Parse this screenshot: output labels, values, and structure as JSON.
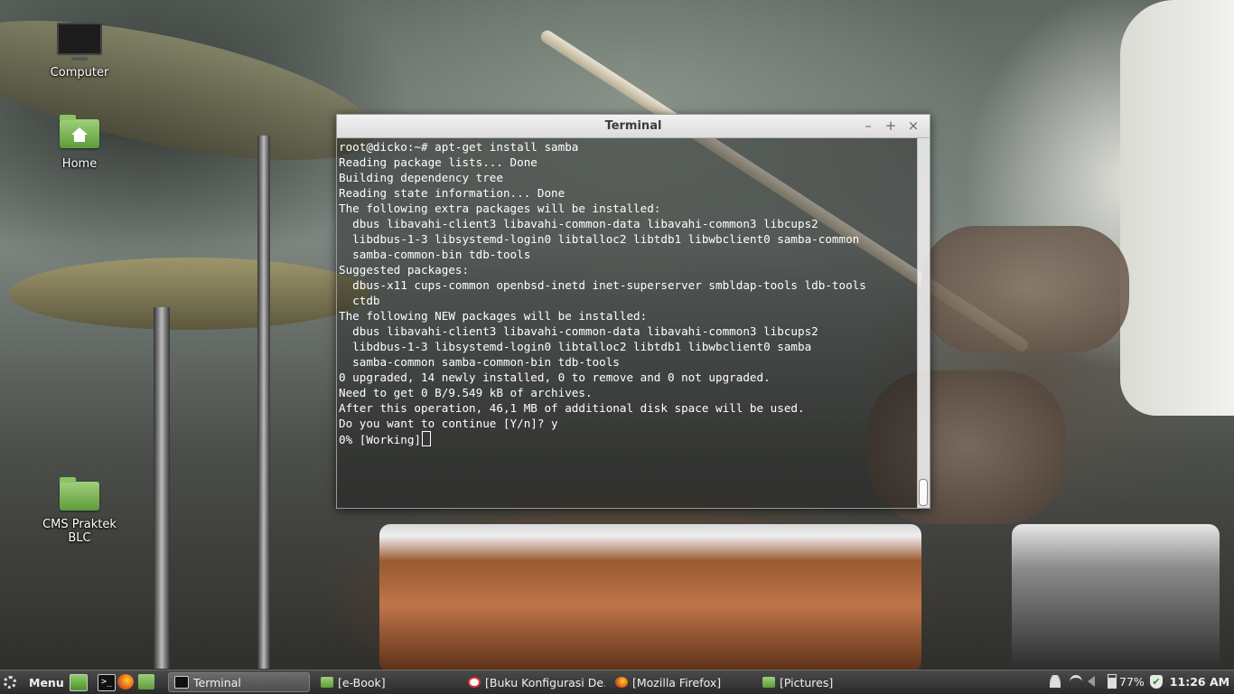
{
  "desktop": {
    "icons": [
      {
        "label": "Computer",
        "icon": "computer-icon"
      },
      {
        "label": "Home",
        "icon": "home-folder-icon"
      },
      {
        "label": "CMS Praktek BLC",
        "icon": "folder-icon"
      }
    ]
  },
  "terminal": {
    "title": "Terminal",
    "buttons": {
      "minimize": "–",
      "maximize": "+",
      "close": "×"
    },
    "lines": [
      "root@dicko:~# apt-get install samba",
      "Reading package lists... Done",
      "Building dependency tree",
      "Reading state information... Done",
      "The following extra packages will be installed:",
      "  dbus libavahi-client3 libavahi-common-data libavahi-common3 libcups2",
      "  libdbus-1-3 libsystemd-login0 libtalloc2 libtdb1 libwbclient0 samba-common",
      "  samba-common-bin tdb-tools",
      "Suggested packages:",
      "  dbus-x11 cups-common openbsd-inetd inet-superserver smbldap-tools ldb-tools",
      "  ctdb",
      "The following NEW packages will be installed:",
      "  dbus libavahi-client3 libavahi-common-data libavahi-common3 libcups2",
      "  libdbus-1-3 libsystemd-login0 libtalloc2 libtdb1 libwbclient0 samba",
      "  samba-common samba-common-bin tdb-tools",
      "0 upgraded, 14 newly installed, 0 to remove and 0 not upgraded.",
      "Need to get 0 B/9.549 kB of archives.",
      "After this operation, 46,1 MB of additional disk space will be used.",
      "Do you want to continue [Y/n]? y",
      "0% [Working]"
    ]
  },
  "taskbar": {
    "menu_label": "Menu",
    "launchers": [
      "show-desktop-icon",
      "terminal-icon",
      "firefox-icon",
      "files-icon"
    ],
    "tasks": [
      {
        "label": "Terminal",
        "icon": "terminal-icon",
        "active": true
      },
      {
        "label": "[e-Book]",
        "icon": "folder-icon",
        "active": false
      },
      {
        "label": "[Buku Konfigurasi De...",
        "icon": "document-viewer-icon",
        "active": false
      },
      {
        "label": "[Mozilla Firefox]",
        "icon": "firefox-icon",
        "active": false
      },
      {
        "label": "[Pictures]",
        "icon": "folder-icon",
        "active": false
      }
    ],
    "tray": {
      "battery": "77%",
      "clock": "11:26 AM"
    }
  },
  "colors": {
    "taskbar_bg": "#333333",
    "folder_green": "#7cb657",
    "terminal_text": "#ffffff"
  }
}
